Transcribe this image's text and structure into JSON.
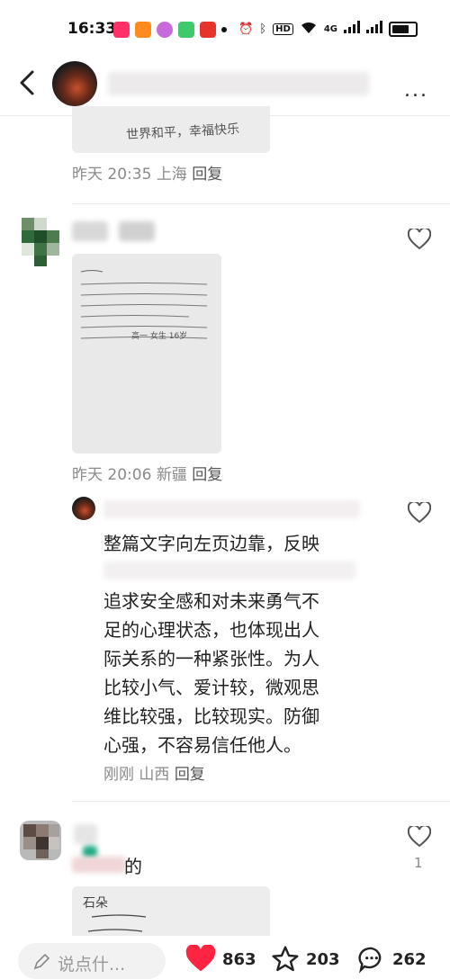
{
  "status_bar": {
    "time": "16:33",
    "indicators": "HD",
    "signal": "4G"
  },
  "top_nav": {
    "more_label": "..."
  },
  "comments": [
    {
      "thumb_text": "世界和平，幸福快乐",
      "time": "昨天 20:35",
      "location": "上海",
      "reply_label": "回复"
    },
    {
      "time": "昨天 20:06",
      "location": "新疆",
      "reply_label": "回复",
      "handwriting_footer": "高一 女生 16岁"
    },
    {
      "reply_lines": [
        "整篇文字向左页边靠，反映",
        "追求安全感和对未来勇气不",
        "足的心理状态，也体现出人",
        "际关系的一种紧张性。为人",
        "比较小气、爱计较，微观思",
        "维比较强，比较现实。防御",
        "心强，不容易信任他人。"
      ],
      "time": "刚刚",
      "location": "山西",
      "reply_label": "回复"
    },
    {
      "text_suffix": "的",
      "like_count": "1",
      "thumb_text": "石朵"
    }
  ],
  "bottom_bar": {
    "comment_placeholder": "说点什...",
    "likes": "863",
    "favorites": "203",
    "comments": "262",
    "accent": "#ff2442"
  }
}
